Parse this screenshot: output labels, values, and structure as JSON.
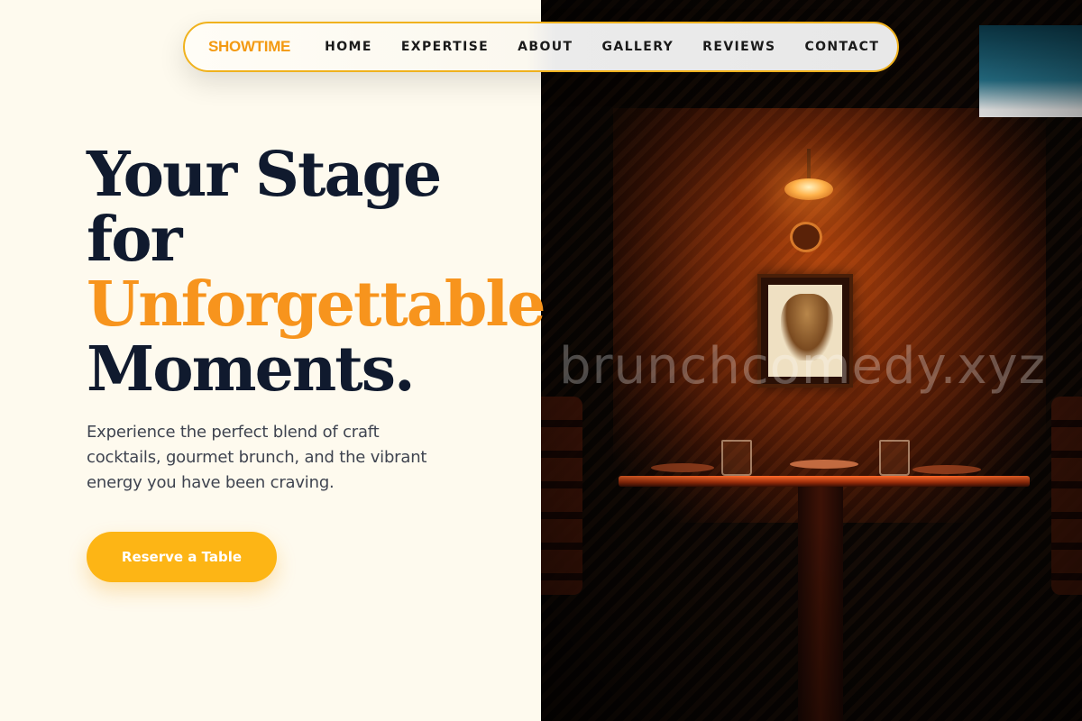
{
  "nav": {
    "brand": "SHOWTIME",
    "links": [
      "HOME",
      "EXPERTISE",
      "ABOUT",
      "GALLERY",
      "REVIEWS",
      "CONTACT"
    ]
  },
  "hero": {
    "headline_line1": "Your Stage",
    "headline_line2": "for",
    "headline_accent": "Unforgettable",
    "headline_line4": "Moments.",
    "subtext": "Experience the perfect blend of craft cocktails, gourmet brunch, and the vibrant energy you have been craving.",
    "cta_label": "Reserve a Table"
  },
  "image": {
    "watermark": "brunchcomedy.xyz"
  },
  "colors": {
    "accent": "#f7941d",
    "button": "#fdb515",
    "headline": "#101a2e",
    "nav_border": "#f0b21e"
  }
}
